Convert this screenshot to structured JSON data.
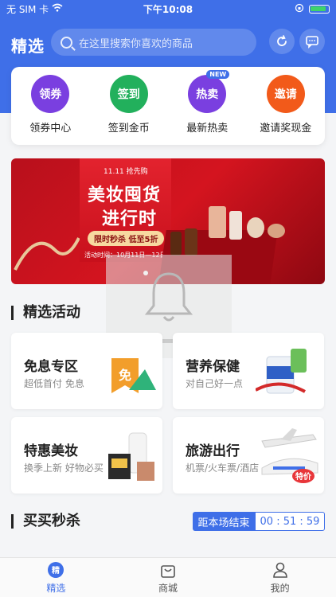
{
  "status_bar": {
    "carrier": "无 SIM 卡",
    "time": "下午10:08"
  },
  "header": {
    "brand": "精选",
    "search_placeholder": "在这里搜索你喜欢的商品"
  },
  "quick_actions": [
    {
      "label": "领券中心",
      "icon_text": "领券",
      "color": "#7a3fe0"
    },
    {
      "label": "签到金币",
      "icon_text": "签到",
      "color": "#22b05c"
    },
    {
      "label": "最新热卖",
      "icon_text": "热卖",
      "badge": "NEW",
      "color": "#7a3fe0"
    },
    {
      "label": "邀请奖现金",
      "icon_text": "邀请",
      "color": "#f25a1a"
    }
  ],
  "banner": {
    "tag": "11.11 抢先购",
    "title_line1": "美妆囤货",
    "title_line2": "进行时",
    "sale": "限时秒杀 低至5折",
    "date": "活动时间：10月11日—12日"
  },
  "sections": {
    "featured": "精选活动",
    "flash_sale": "买买秒杀"
  },
  "activities": [
    {
      "title": "免息专区",
      "subtitle": "超低首付 免息",
      "badge": "免"
    },
    {
      "title": "营养保健",
      "subtitle": "对自己好一点"
    },
    {
      "title": "特惠美妆",
      "subtitle": "换季上新 好物必买"
    },
    {
      "title": "旅游出行",
      "subtitle": "机票/火车票/酒店",
      "badge": "特价"
    }
  ],
  "countdown": {
    "label": "距本场结束",
    "time": "00 : 51 : 59"
  },
  "tabbar": [
    {
      "label": "精选",
      "icon": "home-icon",
      "active": true
    },
    {
      "label": "商城",
      "icon": "shop-bag-icon"
    },
    {
      "label": "我的",
      "icon": "user-icon"
    }
  ],
  "colors": {
    "primary": "#3f6fe8",
    "banner_red": "#c8101c"
  }
}
